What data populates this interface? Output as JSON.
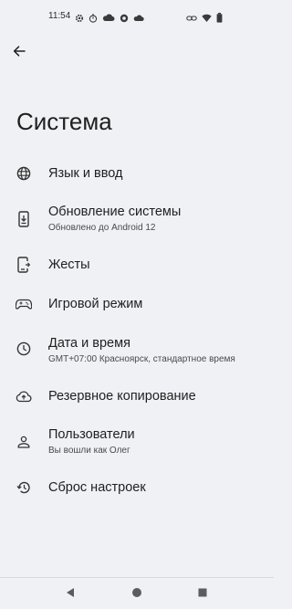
{
  "status_bar": {
    "time": "11:54",
    "left_icons": [
      "gear-icon",
      "timer-icon",
      "cloud-sync-icon",
      "shield-icon",
      "cloud-icon"
    ],
    "right_icons": [
      "link-icon",
      "wifi-icon",
      "battery-icon"
    ]
  },
  "header": {
    "back_icon": "arrow-left-icon",
    "title": "Система"
  },
  "items": [
    {
      "icon": "globe-icon",
      "title": "Язык и ввод",
      "subtitle": ""
    },
    {
      "icon": "system-update-icon",
      "title": "Обновление системы",
      "subtitle": "Обновлено до Android 12"
    },
    {
      "icon": "gesture-phone-icon",
      "title": "Жесты",
      "subtitle": ""
    },
    {
      "icon": "gamepad-icon",
      "title": "Игровой режим",
      "subtitle": ""
    },
    {
      "icon": "clock-icon",
      "title": "Дата и время",
      "subtitle": "GMT+07:00 Красноярск, стандартное время"
    },
    {
      "icon": "cloud-upload-icon",
      "title": "Резервное копирование",
      "subtitle": ""
    },
    {
      "icon": "person-icon",
      "title": "Пользователи",
      "subtitle": "Вы вошли как Олег"
    },
    {
      "icon": "history-icon",
      "title": "Сброс настроек",
      "subtitle": ""
    }
  ],
  "nav_bar": {
    "buttons": [
      "back-triangle-icon",
      "home-circle-icon",
      "recents-square-icon"
    ]
  },
  "colors": {
    "background": "#eff1f5",
    "text_primary": "#1f1f1f",
    "text_secondary": "#4a4a4a"
  }
}
